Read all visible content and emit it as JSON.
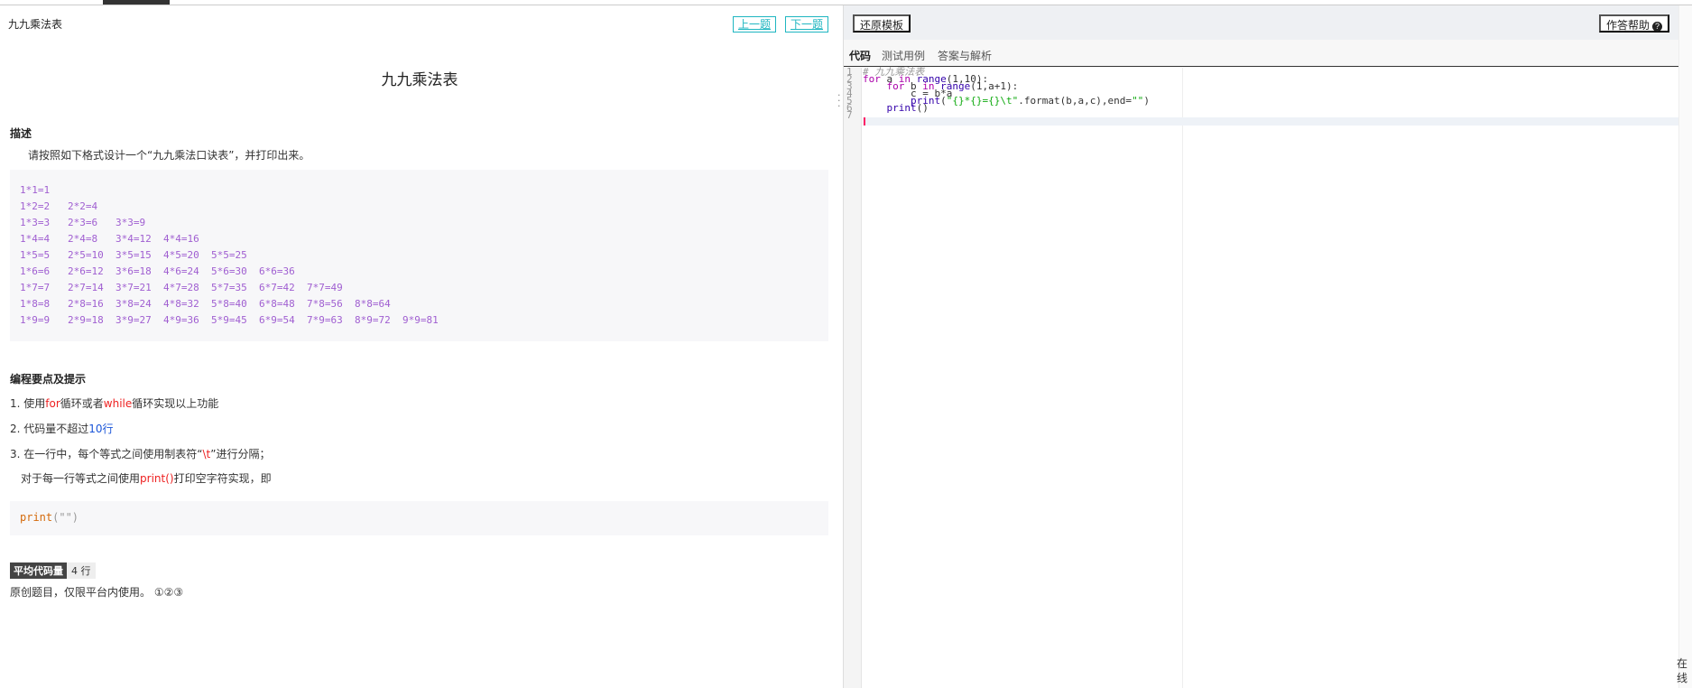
{
  "left_panel": {
    "breadcrumb": "九九乘法表",
    "prev_label": "上一题",
    "next_label": "下一题",
    "title": "九九乘法表",
    "desc_heading": "描述",
    "desc_text": "请按照如下格式设计一个“九九乘法口诀表”，并打印出来。",
    "table_rows": [
      [
        "1*1=1"
      ],
      [
        "1*2=2",
        "2*2=4"
      ],
      [
        "1*3=3",
        "2*3=6",
        "3*3=9"
      ],
      [
        "1*4=4",
        "2*4=8",
        "3*4=12",
        "4*4=16"
      ],
      [
        "1*5=5",
        "2*5=10",
        "3*5=15",
        "4*5=20",
        "5*5=25"
      ],
      [
        "1*6=6",
        "2*6=12",
        "3*6=18",
        "4*6=24",
        "5*6=30",
        "6*6=36"
      ],
      [
        "1*7=7",
        "2*7=14",
        "3*7=21",
        "4*7=28",
        "5*7=35",
        "6*7=42",
        "7*7=49"
      ],
      [
        "1*8=8",
        "2*8=16",
        "3*8=24",
        "4*8=32",
        "5*8=40",
        "6*8=48",
        "7*8=56",
        "8*8=64"
      ],
      [
        "1*9=9",
        "2*9=18",
        "3*9=27",
        "4*9=36",
        "5*9=45",
        "6*9=54",
        "7*9=63",
        "8*9=72",
        "9*9=81"
      ]
    ],
    "tips_heading": "编程要点及提示",
    "tip1": {
      "prefix": "1. 使用",
      "for": "for",
      "mid": "循环或者",
      "while": "while",
      "suffix": "循环实现以上功能"
    },
    "tip2": {
      "prefix": "2. 代码量不超过",
      "highlight": "10行"
    },
    "tip3": {
      "prefix": "3. 在一行中，每个等式之间使用制表符“",
      "highlight": "\\t",
      "suffix": "”进行分隔；"
    },
    "tip4": {
      "prefix": "对于每一行等式之间使用",
      "highlight": "print()",
      "suffix": "打印空字符实现，即"
    },
    "print_code": {
      "fn": "print",
      "args": "(\"\")"
    },
    "avg_label": "平均代码量",
    "avg_value": "4 行",
    "license_text": "原创题目，仅限平台内使用。",
    "license_icons": "①②③"
  },
  "right_panel": {
    "restore_label": "还原模板",
    "help_label": "作答帮助",
    "help_icon": "?",
    "tabs": [
      "代码",
      "测试用例",
      "答案与解析"
    ],
    "code_lines": [
      "# 九九乘法表",
      "for a in range(1,10):",
      "    for b in range(1,a+1):",
      "        c = b*a",
      "        print(\"{}*{}={}\\t\".format(b,a,c),end=\"\")",
      "    print()",
      ""
    ]
  },
  "online_label": "在线"
}
